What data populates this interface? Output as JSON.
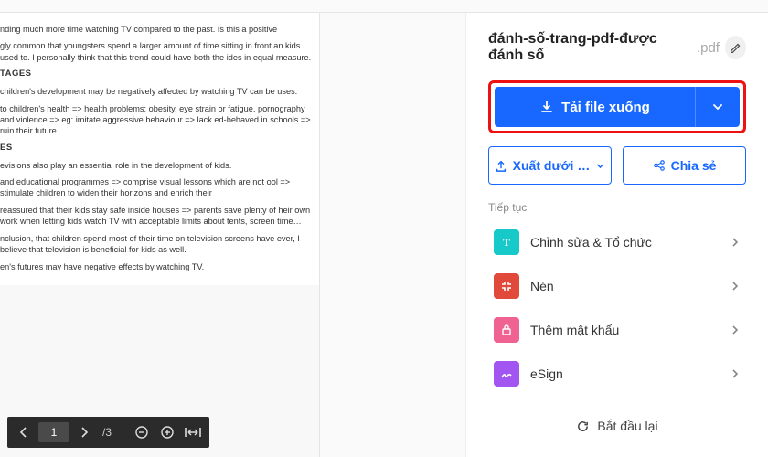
{
  "file": {
    "name": "đánh-số-trang-pdf-được đánh số",
    "ext": ".pdf"
  },
  "download": {
    "label": "Tải file xuống"
  },
  "secondary": {
    "export": "Xuất dưới …",
    "share": "Chia sẻ"
  },
  "continue_label": "Tiếp tục",
  "actions": {
    "edit": "Chỉnh sửa & Tổ chức",
    "compress": "Nén",
    "password": "Thêm mật khẩu",
    "esign": "eSign"
  },
  "colors": {
    "edit": "#18c9c9",
    "compress": "#e14a3a",
    "password": "#f06292",
    "esign": "#a255f0"
  },
  "restart": "Bắt đầu lại",
  "pdf_toolbar": {
    "page": "1",
    "total": "/3"
  },
  "doc": {
    "p1": "nding much more time watching TV compared to the past. Is this a positive",
    "p2": "gly common that youngsters spend a larger amount of time sitting in front an kids used to. I personally think that this trend could have both the ides in equal measure.",
    "h1": "TAGES",
    "p3": "children's development may be negatively affected by watching TV can be uses.",
    "p4": "to children's health => health problems: obesity, eye strain or fatigue. pornography and violence => eg: imitate aggressive behaviour => lack ed-behaved in schools => ruin their future",
    "h2": "ES",
    "p5": "evisions also play an essential role in the development of kids.",
    "p6": "and educational programmes => comprise visual lessons which are not ool => stimulate children to widen their horizons and enrich their",
    "p7": "reassured that their kids stay safe inside houses => parents save plenty of heir own work when letting kids watch TV with acceptable limits about tents, screen time…",
    "p8": "nclusion, that children spend most of their time on television screens have ever, I believe that television is beneficial for kids as well.",
    "p9": "en's futures may have negative effects by watching TV."
  }
}
